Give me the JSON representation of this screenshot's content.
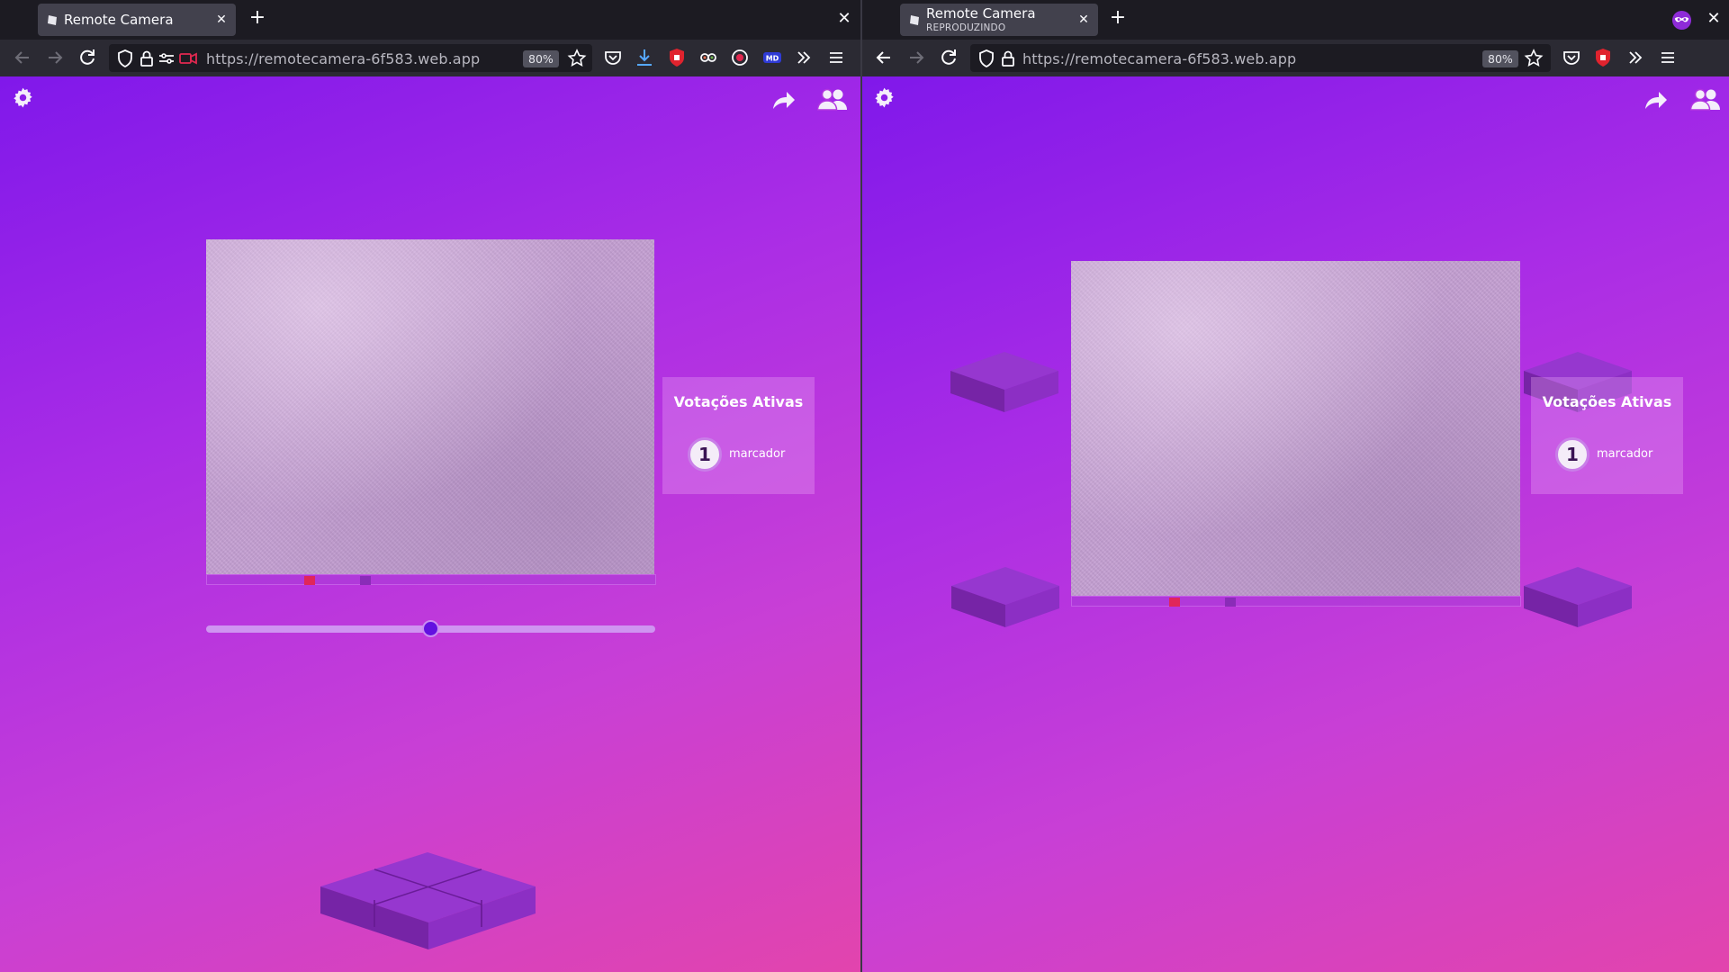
{
  "left": {
    "tab": {
      "title": "Remote Camera"
    },
    "url": "https://remotecamera-6f583.web.app",
    "zoom": "80%",
    "votes": {
      "title": "Votações Ativas",
      "count": "1",
      "label": "marcador"
    },
    "slider_value": 0.5
  },
  "right": {
    "tab": {
      "title": "Remote Camera",
      "subtitle": "REPRODUZINDO"
    },
    "url": "https://remotecamera-6f583.web.app",
    "zoom": "80%",
    "votes": {
      "title": "Votações Ativas",
      "count": "1",
      "label": "marcador"
    }
  },
  "icons": {
    "settings": "gear-icon",
    "share": "share-arrow-icon",
    "users": "users-icon"
  },
  "colors": {
    "accent": "#6210e0",
    "marker_red": "#e0265a",
    "marker_purple": "#8a2cb8"
  }
}
